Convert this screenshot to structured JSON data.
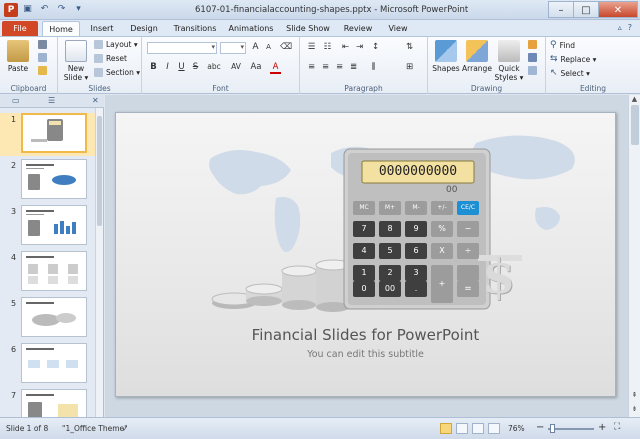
{
  "window": {
    "title": "6107-01-financialaccounting-shapes.pptx - Microsoft PowerPoint",
    "app_icon_letter": "P",
    "qat_icons": [
      "save-icon",
      "undo-icon",
      "redo-icon",
      "customize-icon"
    ],
    "controls": [
      "–",
      "□",
      "✕"
    ]
  },
  "tabs": [
    {
      "label": "File",
      "left": 0
    },
    {
      "label": "Home"
    },
    {
      "label": "Insert"
    },
    {
      "label": "Design"
    },
    {
      "label": "Transitions"
    },
    {
      "label": "Animations"
    },
    {
      "label": "Slide Show"
    },
    {
      "label": "Review"
    },
    {
      "label": "View"
    }
  ],
  "ribbon_controls": [
    "▵",
    "?"
  ],
  "ribbon": {
    "clipboard": {
      "label": "Clipboard",
      "paste": "Paste"
    },
    "slides": {
      "label": "Slides",
      "new_slide_line1": "New",
      "new_slide_line2": "Slide ▾",
      "layout": "Layout ▾",
      "reset": "Reset",
      "section": "Section ▾"
    },
    "font": {
      "label": "Font",
      "bold": "B",
      "italic": "I",
      "underline": "U",
      "strike": "S",
      "shadow": "abc",
      "spacing": "AV",
      "case": "Aa",
      "color": "A",
      "grow": "A",
      "shrink": "A"
    },
    "paragraph": {
      "label": "Paragraph"
    },
    "drawing": {
      "label": "Drawing",
      "shapes": "Shapes",
      "arrange": "Arrange",
      "quick_styles_line1": "Quick",
      "quick_styles_line2": "Styles ▾"
    },
    "editing": {
      "label": "Editing",
      "find": "Find",
      "replace": "Replace ▾",
      "select": "Select ▾"
    }
  },
  "pane": {
    "close": "✕"
  },
  "thumbnails": [
    {
      "num": "1",
      "title": ""
    },
    {
      "num": "2",
      "title": "Financial Slides for PowerPoint"
    },
    {
      "num": "3",
      "title": "Financial Slides for PowerPoint"
    },
    {
      "num": "4",
      "title": "Financial Slides for PowerPoint"
    },
    {
      "num": "5",
      "title": "Financial Slides for PowerPoint"
    },
    {
      "num": "6",
      "title": "Financial Slides for PowerPoint"
    },
    {
      "num": "7",
      "title": "Financial Slides for PowerPoint"
    }
  ],
  "slide": {
    "title": "Financial Slides for PowerPoint",
    "subtitle": "You can edit this subtitle",
    "display": "0000000000",
    "display_small": "00",
    "keys": [
      [
        "MC",
        "M+",
        "M-",
        "+/-",
        "CE/C"
      ],
      [
        "7",
        "8",
        "9",
        "%",
        "−"
      ],
      [
        "4",
        "5",
        "6",
        "X",
        "÷"
      ],
      [
        "1",
        "2",
        "3",
        "+",
        ""
      ],
      [
        "0",
        "00",
        ".",
        "",
        "="
      ]
    ],
    "dollar": "$"
  },
  "status": {
    "slide_of": "Slide 1 of 8",
    "theme": "\"1_Office Theme\"",
    "zoom": "76%",
    "zoom_minus": "−",
    "zoom_plus": "+"
  }
}
